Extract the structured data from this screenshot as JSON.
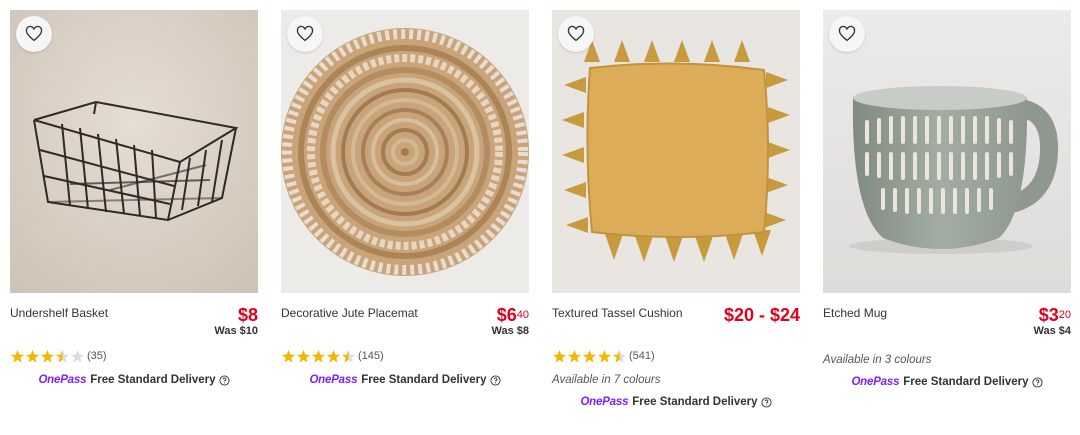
{
  "products": [
    {
      "title": "Undershelf Basket",
      "price_main": "$8",
      "price_cents": "",
      "was": "Was $10",
      "rating": 3.5,
      "reviews": "(35)",
      "colours": "",
      "onepass": "OnePass",
      "delivery": "Free Standard Delivery",
      "image": "wire-basket"
    },
    {
      "title": "Decorative Jute Placemat",
      "price_main": "$6",
      "price_cents": "40",
      "was": "Was $8",
      "rating": 4.5,
      "reviews": "(145)",
      "colours": "",
      "onepass": "OnePass",
      "delivery": "Free Standard Delivery",
      "image": "jute-placemat"
    },
    {
      "title": "Textured Tassel Cushion",
      "price_main": "$20 - $24",
      "price_cents": "",
      "was": "",
      "rating": 4.5,
      "reviews": "(541)",
      "colours": "Available in 7 colours",
      "onepass": "OnePass",
      "delivery": "Free Standard Delivery",
      "image": "tassel-cushion"
    },
    {
      "title": "Etched Mug",
      "price_main": "$3",
      "price_cents": "20",
      "was": "Was $4",
      "rating": null,
      "reviews": "",
      "colours": "Available in 3 colours",
      "onepass": "OnePass",
      "delivery": "Free Standard Delivery",
      "image": "etched-mug"
    }
  ],
  "colors": {
    "price": "#e1001a",
    "star": "#f2b705",
    "onepass": "#7b1fff"
  },
  "icons": [
    "heart-icon",
    "star-icon",
    "help-circle-icon"
  ]
}
